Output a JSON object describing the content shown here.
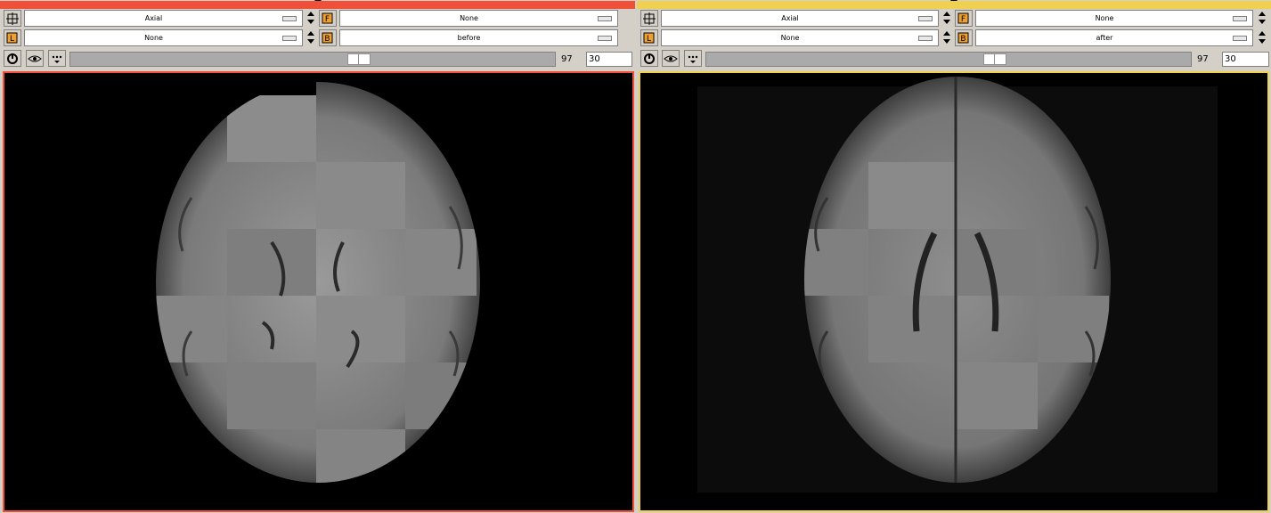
{
  "colors": {
    "left_accent": "#f0503a",
    "right_accent": "#f0d050",
    "toolbar_bg": "#d4d0c8",
    "viewer_bg": "#000000"
  },
  "icons": [
    "slice-layout-icon",
    "label-volume-icon",
    "foreground-volume-icon",
    "background-volume-icon",
    "link-icon",
    "visibility-eye-icon",
    "more-options-icon",
    "spinner-up-icon",
    "spinner-down-icon",
    "dropdown-icon"
  ],
  "left": {
    "orientation": "Axial",
    "foreground": "None",
    "label": "None",
    "background": "before",
    "slice_number": "97",
    "slice_position": 0.6,
    "offset_value": "30"
  },
  "right": {
    "orientation": "Axial",
    "foreground": "None",
    "label": "None",
    "background": "after",
    "slice_number": "97",
    "slice_position": 0.6,
    "offset_value": "30"
  }
}
